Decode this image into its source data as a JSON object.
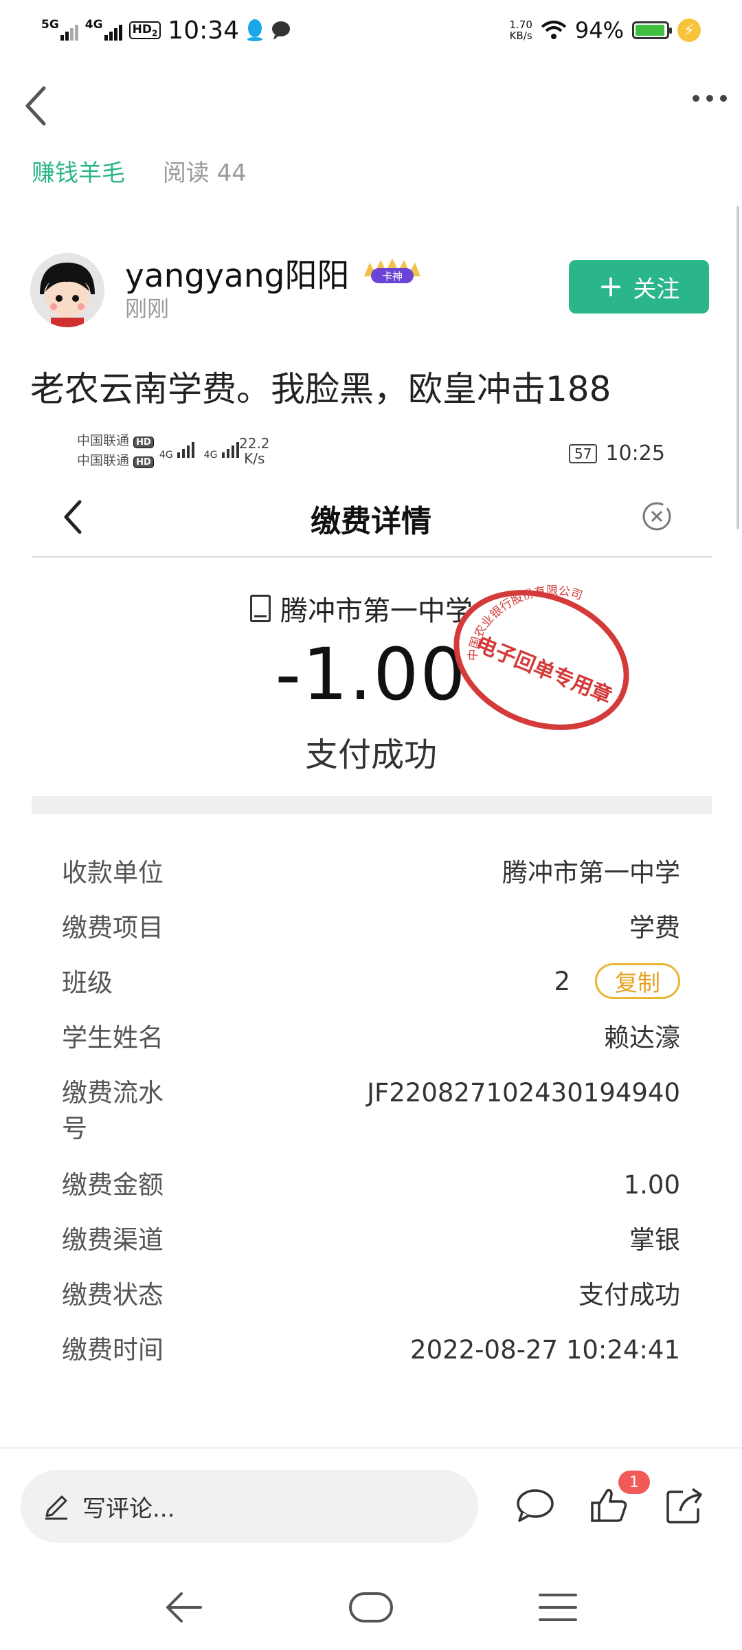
{
  "status_bar": {
    "network1": "5G",
    "network2": "4G",
    "hd": "HD",
    "hd_sub": "2",
    "time": "10:34",
    "speed_value": "1.70",
    "speed_unit": "KB/s",
    "battery": "94%"
  },
  "header": {
    "tag": "赚钱羊毛",
    "reads": "阅读 44"
  },
  "author": {
    "name": "yangyang阳阳",
    "time": "刚刚",
    "badge_text": "卡神",
    "follow_label": "关注"
  },
  "post": {
    "text": "老农云南学费。我脸黑，欧皇冲击188"
  },
  "embedded": {
    "status": {
      "carrier1": "中国联通",
      "carrier2": "中国联通",
      "hd": "HD",
      "net": "4G",
      "speed_value": "22.2",
      "speed_unit": "K/s",
      "battery": "57",
      "time": "10:25"
    },
    "title": "缴费详情",
    "school": "腾冲市第一中学",
    "amount": "-1.00",
    "status_text": "支付成功",
    "stamp_top": "中国农业银行股份有限公司",
    "stamp_main": "电子回单专用章",
    "rows": [
      {
        "label": "收款单位",
        "value": "腾冲市第一中学"
      },
      {
        "label": "缴费项目",
        "value": "学费"
      },
      {
        "label": "班级",
        "value": "2"
      },
      {
        "label": "学生姓名",
        "value": "赖达濠"
      },
      {
        "label": "缴费流水号",
        "value": "JF220827102430194940"
      },
      {
        "label": "缴费金额",
        "value": "1.00"
      },
      {
        "label": "缴费渠道",
        "value": "掌银"
      },
      {
        "label": "缴费状态",
        "value": "支付成功"
      },
      {
        "label": "缴费时间",
        "value": "2022-08-27 10:24:41"
      }
    ],
    "copy_label": "复制"
  },
  "bottom_bar": {
    "comment_placeholder": "写评论...",
    "like_count": "1"
  },
  "colors": {
    "accent": "#2bb58a",
    "copy": "#e9a020",
    "stamp": "#d43a3a",
    "badge": "#f25a5a"
  },
  "icons": [
    "back-icon",
    "more-icon",
    "plus-icon",
    "book-icon",
    "close-icon",
    "pen-icon",
    "comment-icon",
    "like-icon",
    "share-icon",
    "nav-back-icon",
    "nav-home-icon",
    "nav-menu-icon"
  ]
}
